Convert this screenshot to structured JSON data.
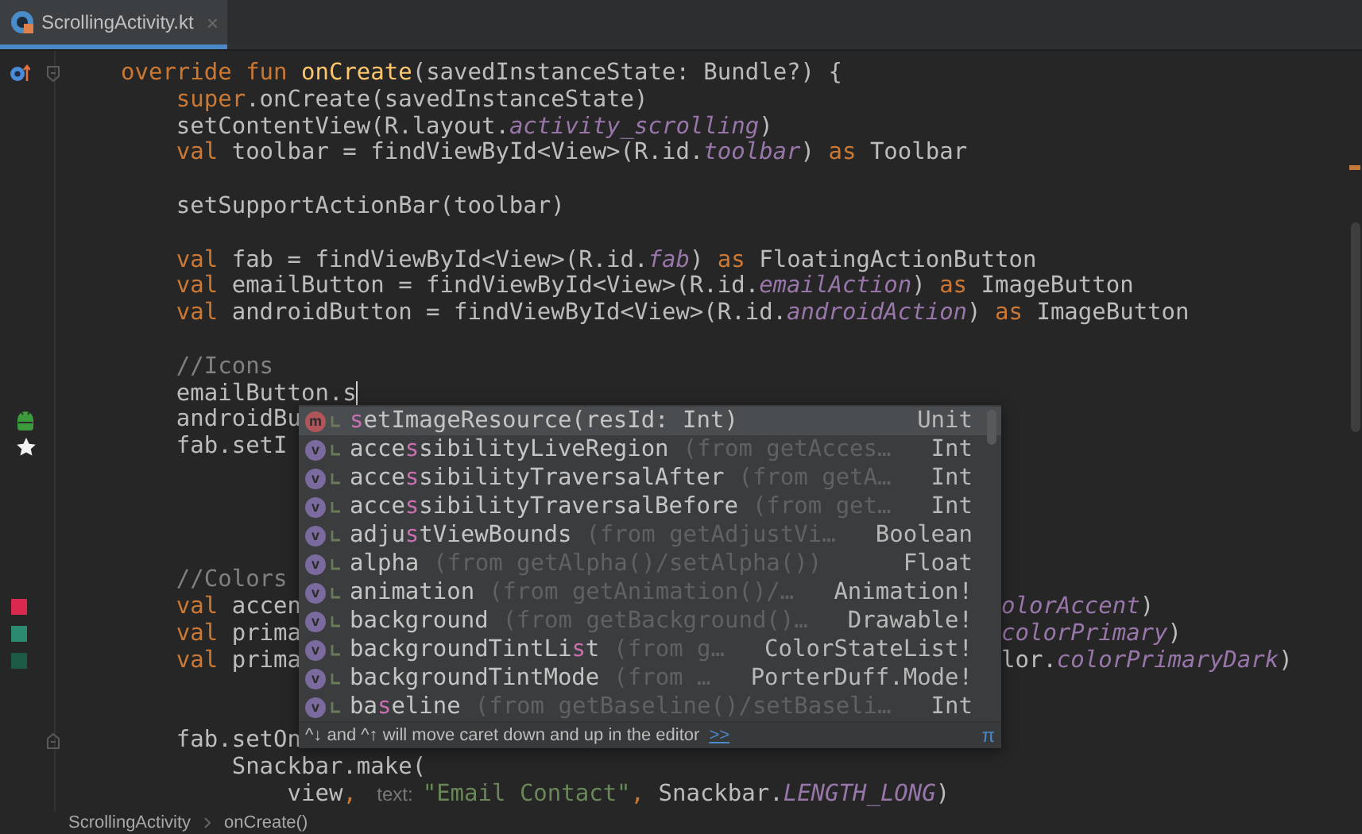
{
  "tabs": [
    {
      "label": "ScrollingActivity.kt",
      "close": "×",
      "selected": true
    }
  ],
  "code_lines": [
    {
      "kind": "code",
      "gutter": [
        {
          "kind": "override"
        },
        {
          "kind": "fold-start"
        }
      ],
      "tokens": [
        {
          "kind": "kw",
          "text": "override fun "
        },
        {
          "kind": "fn",
          "text": "onCreate"
        },
        {
          "kind": "plain",
          "text": "(savedInstanceState: Bundle?) {"
        }
      ]
    },
    {
      "kind": "code",
      "tokens": [
        {
          "kind": "kw",
          "text": "    super"
        },
        {
          "kind": "plain",
          "text": ".onCreate(savedInstanceState)"
        }
      ]
    },
    {
      "kind": "code",
      "tokens": [
        {
          "kind": "plain",
          "text": "    setContentView(R.layout."
        },
        {
          "kind": "field",
          "text": "activity_scrolling"
        },
        {
          "kind": "plain",
          "text": ")"
        }
      ]
    },
    {
      "kind": "code",
      "tokens": [
        {
          "kind": "kw",
          "text": "    val "
        },
        {
          "kind": "plain",
          "text": "toolbar = findViewById<View>(R.id."
        },
        {
          "kind": "field",
          "text": "toolbar"
        },
        {
          "kind": "plain",
          "text": ") "
        },
        {
          "kind": "kw",
          "text": "as "
        },
        {
          "kind": "plain",
          "text": "Toolbar"
        }
      ]
    },
    {
      "kind": "blank"
    },
    {
      "kind": "code",
      "tokens": [
        {
          "kind": "plain",
          "text": "    setSupportActionBar(toolbar)"
        }
      ]
    },
    {
      "kind": "blank"
    },
    {
      "kind": "code",
      "tokens": [
        {
          "kind": "kw",
          "text": "    val "
        },
        {
          "kind": "plain",
          "text": "fab = findViewById<View>(R.id."
        },
        {
          "kind": "field",
          "text": "fab"
        },
        {
          "kind": "plain",
          "text": ") "
        },
        {
          "kind": "kw",
          "text": "as "
        },
        {
          "kind": "plain",
          "text": "FloatingActionButton"
        }
      ]
    },
    {
      "kind": "code",
      "tokens": [
        {
          "kind": "kw",
          "text": "    val "
        },
        {
          "kind": "plain",
          "text": "emailButton = findViewById<View>(R.id."
        },
        {
          "kind": "field",
          "text": "emailAction"
        },
        {
          "kind": "plain",
          "text": ") "
        },
        {
          "kind": "kw",
          "text": "as "
        },
        {
          "kind": "plain",
          "text": "ImageButton"
        }
      ]
    },
    {
      "kind": "code",
      "tokens": [
        {
          "kind": "kw",
          "text": "    val "
        },
        {
          "kind": "plain",
          "text": "androidButton = findViewById<View>(R.id."
        },
        {
          "kind": "field",
          "text": "androidAction"
        },
        {
          "kind": "plain",
          "text": ") "
        },
        {
          "kind": "kw",
          "text": "as "
        },
        {
          "kind": "plain",
          "text": "ImageButton"
        }
      ]
    },
    {
      "kind": "blank"
    },
    {
      "kind": "code",
      "tokens": [
        {
          "kind": "comment",
          "text": "    //Icons"
        }
      ]
    },
    {
      "kind": "code",
      "caret": true,
      "tokens": [
        {
          "kind": "plain",
          "text": "    emailButton.s"
        }
      ]
    },
    {
      "kind": "code",
      "gutter": [
        {
          "kind": "android"
        }
      ],
      "tokens": [
        {
          "kind": "plain",
          "text": "    androidBu"
        }
      ]
    },
    {
      "kind": "code",
      "gutter": [
        {
          "kind": "star"
        }
      ],
      "tokens": [
        {
          "kind": "plain",
          "text": "    fab.setI"
        }
      ]
    },
    {
      "kind": "blank"
    },
    {
      "kind": "blank"
    },
    {
      "kind": "blank"
    },
    {
      "kind": "blank"
    },
    {
      "kind": "code",
      "tokens": [
        {
          "kind": "comment",
          "text": "    //Colors"
        }
      ]
    },
    {
      "kind": "code",
      "gutter": [
        {
          "kind": "swatch",
          "color": "#d9294f"
        }
      ],
      "tokens": [
        {
          "kind": "kw",
          "text": "    val "
        },
        {
          "kind": "plain",
          "text": "accen"
        }
      ],
      "tail": [
        {
          "kind": "field",
          "text": "olorAccent"
        },
        {
          "kind": "plain",
          "text": ")"
        }
      ]
    },
    {
      "kind": "code",
      "gutter": [
        {
          "kind": "swatch",
          "color": "#2b8a70"
        }
      ],
      "tokens": [
        {
          "kind": "kw",
          "text": "    val "
        },
        {
          "kind": "plain",
          "text": "prima"
        }
      ],
      "tail": [
        {
          "kind": "field",
          "text": "colorPrimary"
        },
        {
          "kind": "plain",
          "text": ")"
        }
      ]
    },
    {
      "kind": "code",
      "gutter": [
        {
          "kind": "swatch",
          "color": "#1d5a45"
        }
      ],
      "tokens": [
        {
          "kind": "kw",
          "text": "    val "
        },
        {
          "kind": "plain",
          "text": "prima"
        }
      ],
      "tail": [
        {
          "kind": "plain",
          "text": "lor."
        },
        {
          "kind": "field",
          "text": "colorPrimaryDark"
        },
        {
          "kind": "plain",
          "text": ")"
        }
      ]
    },
    {
      "kind": "blank"
    },
    {
      "kind": "blank"
    },
    {
      "kind": "code",
      "gutter": [
        {
          "kind": "fold-end"
        }
      ],
      "tokens": [
        {
          "kind": "plain",
          "text": "    fab.setOn"
        }
      ]
    },
    {
      "kind": "code",
      "tokens": [
        {
          "kind": "plain",
          "text": "        Snackbar.make("
        }
      ]
    },
    {
      "kind": "code",
      "tokens": [
        {
          "kind": "plain",
          "text": "            view"
        },
        {
          "kind": "kw",
          "text": ", "
        },
        {
          "kind": "hint",
          "text": "text:"
        },
        {
          "kind": "string",
          "text": "\"Email Contact\""
        },
        {
          "kind": "kw",
          "text": ", "
        },
        {
          "kind": "plain",
          "text": "Snackbar."
        },
        {
          "kind": "field",
          "text": "LENGTH_LONG"
        },
        {
          "kind": "plain",
          "text": ")"
        }
      ]
    }
  ],
  "completion": {
    "items": [
      {
        "kind": "method",
        "letter": "m",
        "match": "s",
        "after": "etImageResource(resId: Int)",
        "type": "Unit",
        "selected": true
      },
      {
        "kind": "property",
        "letter": "v",
        "before": "acce",
        "match": "s",
        "after": "sibilityLiveRegion",
        "hint": "(from getAcces…",
        "type": "Int",
        "selected": false
      },
      {
        "kind": "property",
        "letter": "v",
        "before": "acce",
        "match": "s",
        "after": "sibilityTraversalAfter",
        "hint": "(from getA…",
        "type": "Int",
        "selected": false
      },
      {
        "kind": "property",
        "letter": "v",
        "before": "acce",
        "match": "s",
        "after": "sibilityTraversalBefore",
        "hint": "(from get…",
        "type": "Int",
        "selected": false
      },
      {
        "kind": "property",
        "letter": "v",
        "before": "adju",
        "match": "s",
        "after": "tViewBounds",
        "hint": "(from getAdjustVi…",
        "type": "Boolean",
        "selected": false
      },
      {
        "kind": "property",
        "letter": "v",
        "before": "alpha",
        "hint": "(from getAlpha()/setAlpha())",
        "type": "Float",
        "selected": false
      },
      {
        "kind": "property",
        "letter": "v",
        "before": "animation",
        "hint": "(from getAnimation()/…",
        "type": "Animation!",
        "selected": false
      },
      {
        "kind": "property",
        "letter": "v",
        "before": "background",
        "hint": "(from getBackground()…",
        "type": "Drawable!",
        "selected": false
      },
      {
        "kind": "property",
        "letter": "v",
        "before": "backgroundTintLi",
        "match": "s",
        "after": "t",
        "hint": "(from g…",
        "type": "ColorStateList!",
        "selected": false
      },
      {
        "kind": "property",
        "letter": "v",
        "before": "backgroundTintMode",
        "hint": "(from …",
        "type": "PorterDuff.Mode!",
        "selected": false
      },
      {
        "kind": "property",
        "letter": "v",
        "before": "ba",
        "match": "s",
        "after": "eline",
        "hint": "(from getBaseline()/setBaseli…",
        "type": "Int",
        "selected": false
      }
    ],
    "footer": "^↓ and ^↑ will move caret down and up in the editor",
    "footer_link": ">>",
    "footer_pin": "π"
  },
  "breadcrumbs": [
    "ScrollingActivity",
    "onCreate()"
  ]
}
